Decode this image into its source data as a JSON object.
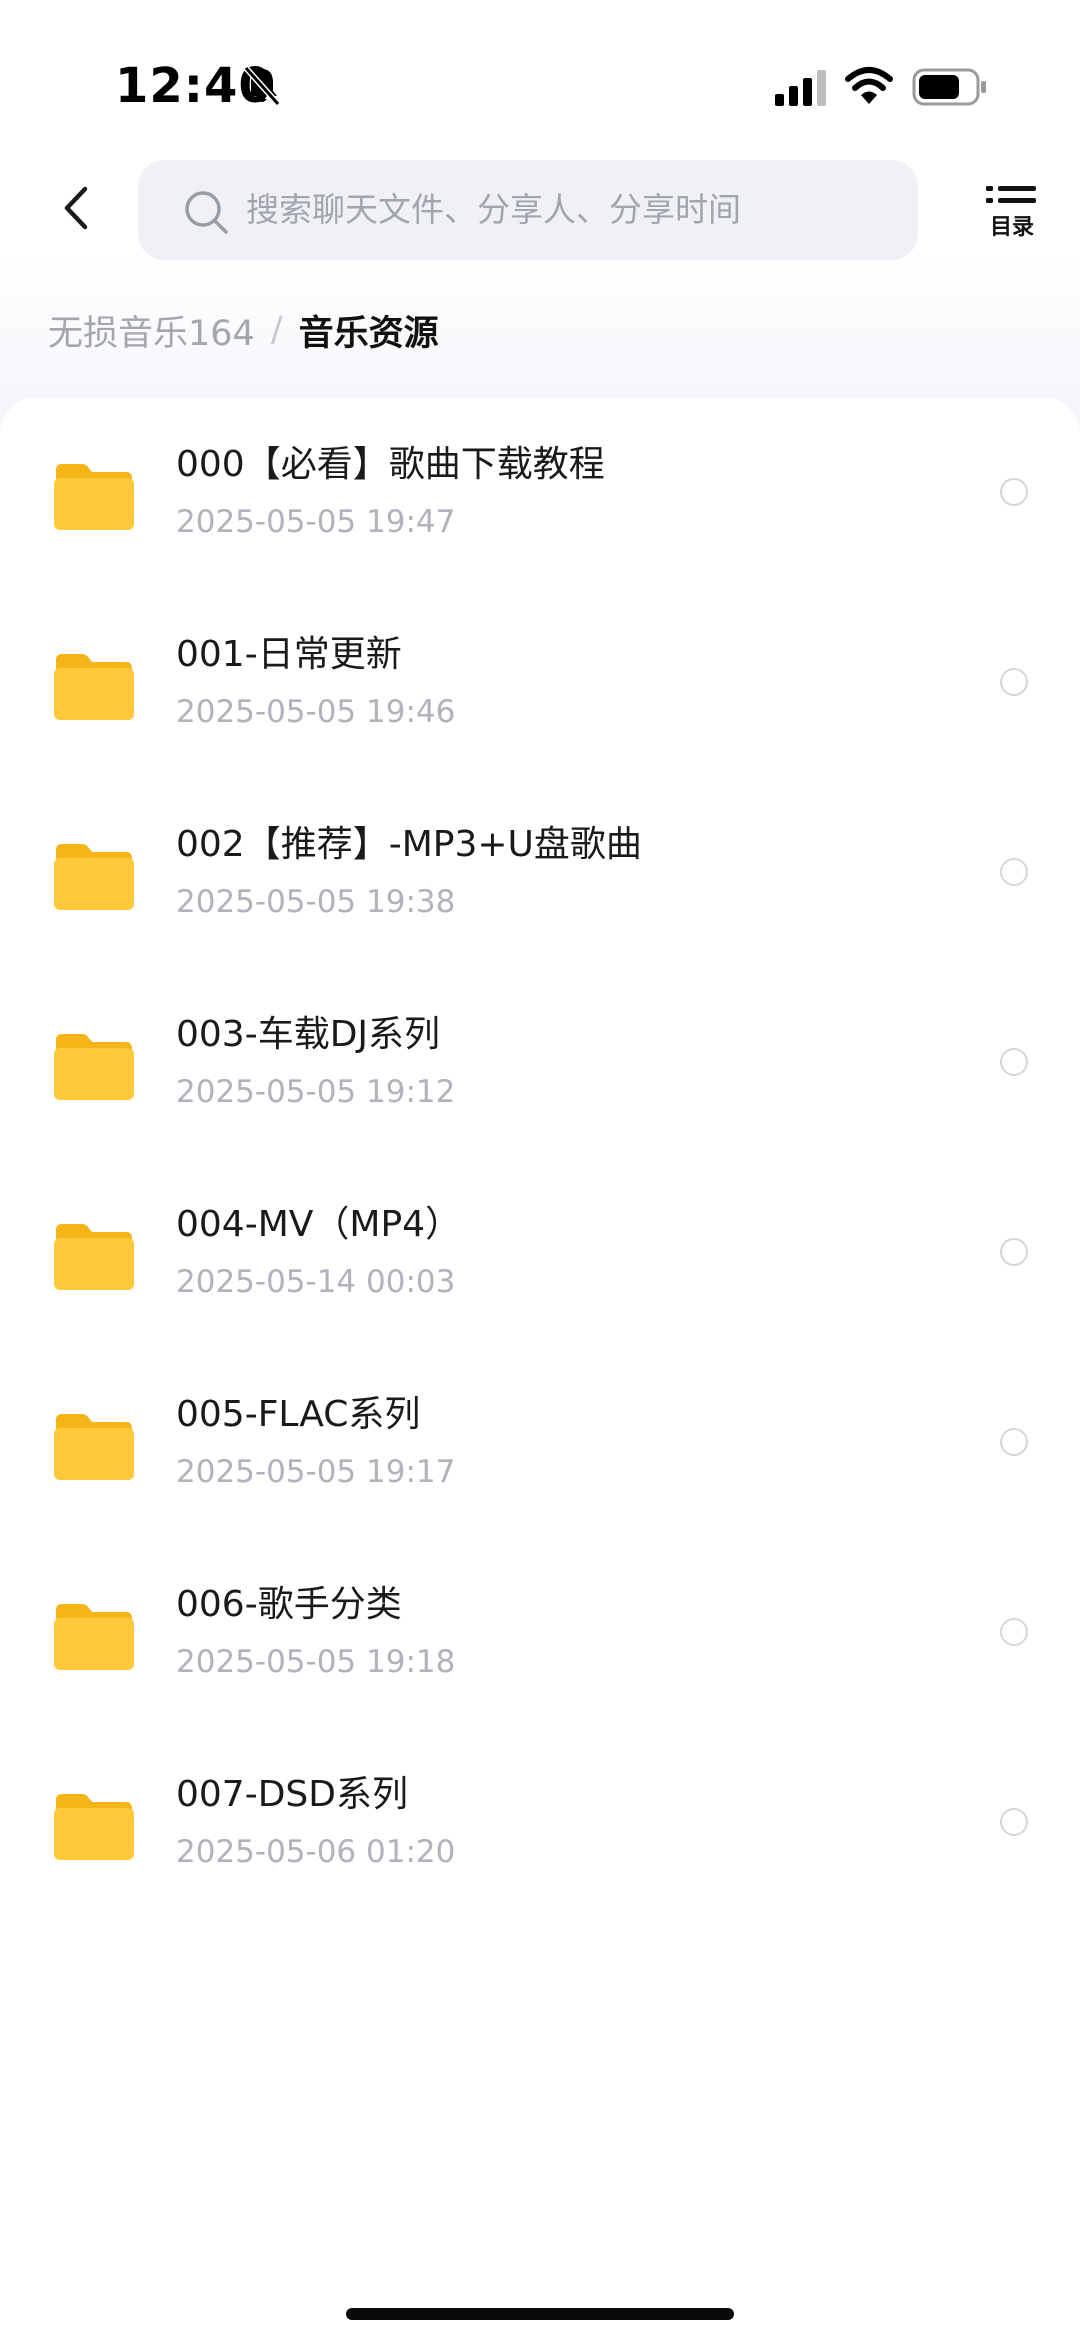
{
  "status_bar": {
    "time": "12:40",
    "icons": [
      "bell-slash-icon",
      "signal-icon",
      "wifi-icon",
      "battery-icon"
    ]
  },
  "header": {
    "back_icon": "chevron-left-icon",
    "search_placeholder": "搜索聊天文件、分享人、分享时间",
    "toc_label": "目录",
    "toc_icon": "list-icon"
  },
  "breadcrumb": {
    "parent": "无损音乐164",
    "separator": "/",
    "current": "音乐资源"
  },
  "items": [
    {
      "name": "000【必看】歌曲下载教程",
      "time": "2025-05-05 19:47"
    },
    {
      "name": "001-日常更新",
      "time": "2025-05-05 19:46"
    },
    {
      "name": "002【推荐】-MP3+U盘歌曲",
      "time": "2025-05-05 19:38"
    },
    {
      "name": "003-车载DJ系列",
      "time": "2025-05-05 19:12"
    },
    {
      "name": "004-MV（MP4）",
      "time": "2025-05-14 00:03"
    },
    {
      "name": "005-FLAC系列",
      "time": "2025-05-05 19:17"
    },
    {
      "name": "006-歌手分类",
      "time": "2025-05-05 19:18"
    },
    {
      "name": "007-DSD系列",
      "time": "2025-05-06 01:20"
    }
  ],
  "colors": {
    "folder": "#ffc93a",
    "folder_dark": "#f5b519",
    "secondary_text": "#b1b3ba",
    "search_bg": "#f0f1f6"
  }
}
